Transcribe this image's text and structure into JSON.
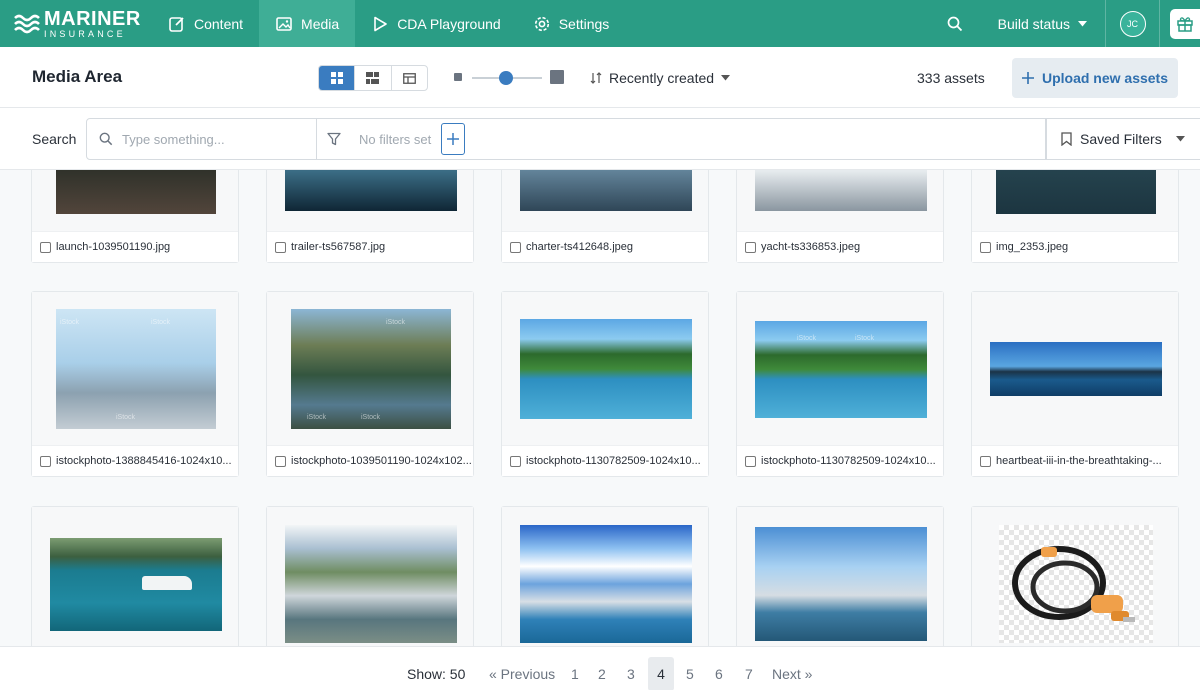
{
  "brand": {
    "name_line1": "MARINER",
    "name_line2": "INSURANCE"
  },
  "nav": {
    "items": [
      {
        "label": "Content",
        "icon": "edit-icon"
      },
      {
        "label": "Media",
        "icon": "image-icon"
      },
      {
        "label": "CDA Playground",
        "icon": "play-icon"
      },
      {
        "label": "Settings",
        "icon": "gear-icon"
      }
    ],
    "active": "Media",
    "build_status": "Build status",
    "user_initials": "JC"
  },
  "header": {
    "title": "Media Area",
    "sort_label": "Recently created",
    "asset_count": "333 assets",
    "upload_label": "Upload new assets",
    "colors": {
      "accent": "#3a7cc0",
      "brand": "#2a9d85"
    }
  },
  "filters": {
    "search_label": "Search",
    "search_placeholder": "Type something...",
    "no_filters": "No filters set",
    "saved_filters": "Saved Filters"
  },
  "assets": [
    {
      "filename": "launch-1039501190.jpg"
    },
    {
      "filename": "trailer-ts567587.jpg"
    },
    {
      "filename": "charter-ts412648.jpeg"
    },
    {
      "filename": "yacht-ts336853.jpeg"
    },
    {
      "filename": "img_2353.jpeg"
    },
    {
      "filename": "istockphoto-1388845416-1024x10..."
    },
    {
      "filename": "istockphoto-1039501190-1024x102..."
    },
    {
      "filename": "istockphoto-1130782509-1024x10..."
    },
    {
      "filename": "istockphoto-1130782509-1024x10..."
    },
    {
      "filename": "heartbeat-iii-in-the-breathtaking-..."
    }
  ],
  "watermark": "iStock",
  "pagination": {
    "show_label": "Show: 50",
    "previous": "« Previous",
    "next": "Next »",
    "pages": [
      "1",
      "2",
      "3",
      "4",
      "5",
      "6",
      "7"
    ],
    "current": "4"
  }
}
